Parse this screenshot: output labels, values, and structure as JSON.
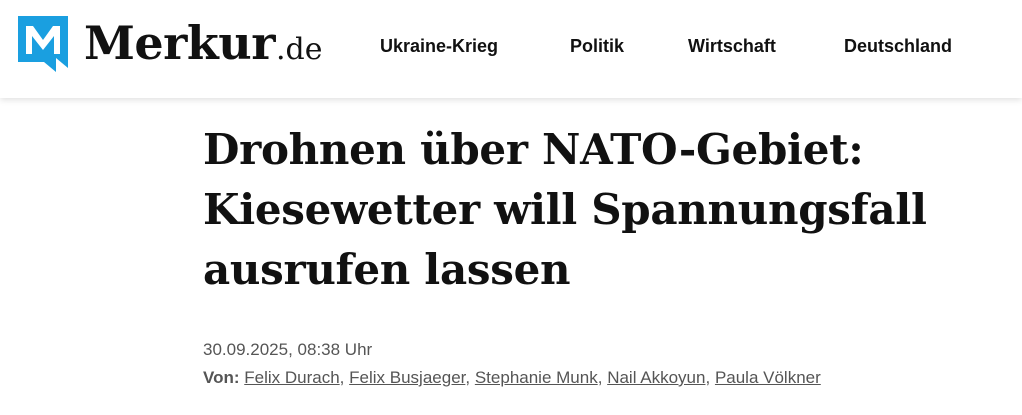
{
  "brand": {
    "name": "Merkur",
    "tld": ".de",
    "accent_color": "#1a9fe0"
  },
  "nav": {
    "items": [
      "Ukraine-Krieg",
      "Politik",
      "Wirtschaft",
      "Deutschland"
    ]
  },
  "article": {
    "headline_lines": [
      "Drohnen über NATO-Gebiet:",
      "Kiesewetter will Spannungsfall",
      "ausrufen lassen"
    ],
    "date": "30.09.2025, 08:38 Uhr",
    "authors_label": "Von:",
    "authors": [
      "Felix Durach",
      "Felix Busjaeger",
      "Stephanie Munk",
      "Nail Akkoyun",
      "Paula Völkner"
    ],
    "separator": ","
  }
}
